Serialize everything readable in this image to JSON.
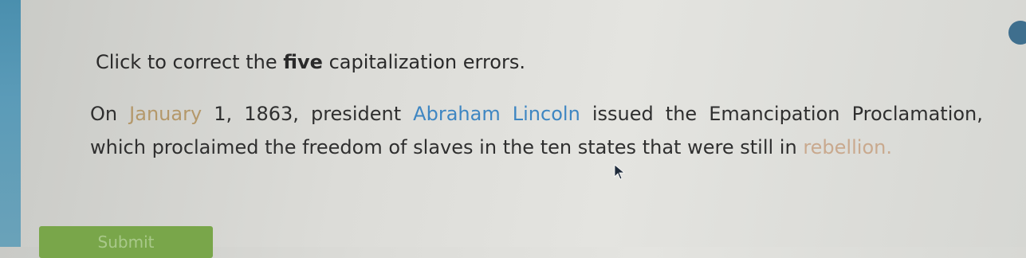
{
  "instructions": {
    "before": "Click to correct the ",
    "bold": "five",
    "after": " capitalization errors."
  },
  "passage": {
    "words": [
      {
        "text": "On",
        "style": "normal"
      },
      {
        "text": "January",
        "style": "amber"
      },
      {
        "text": "1,",
        "style": "normal"
      },
      {
        "text": "1863,",
        "style": "normal"
      },
      {
        "text": "president",
        "style": "normal"
      },
      {
        "text": "Abraham",
        "style": "blue"
      },
      {
        "text": "Lincoln",
        "style": "blue"
      },
      {
        "text": "issued",
        "style": "normal"
      },
      {
        "text": "the",
        "style": "normal"
      },
      {
        "text": "Emancipation",
        "style": "normal"
      },
      {
        "text": "Proclamation,",
        "style": "normal"
      },
      {
        "text": "which",
        "style": "normal"
      },
      {
        "text": "proclaimed",
        "style": "normal"
      },
      {
        "text": "the",
        "style": "normal"
      },
      {
        "text": "freedom",
        "style": "normal"
      },
      {
        "text": "of",
        "style": "normal"
      },
      {
        "text": "slaves",
        "style": "normal"
      },
      {
        "text": "in",
        "style": "normal"
      },
      {
        "text": "the",
        "style": "normal"
      },
      {
        "text": "ten",
        "style": "normal"
      },
      {
        "text": "states",
        "style": "normal"
      },
      {
        "text": "that",
        "style": "normal"
      },
      {
        "text": "were",
        "style": "normal"
      },
      {
        "text": "still",
        "style": "normal"
      },
      {
        "text": "in",
        "style": "normal"
      },
      {
        "text": "rebellion.",
        "style": "faded"
      }
    ]
  },
  "submit": {
    "label": "Submit"
  },
  "colors": {
    "blue_word": "#3e86c2",
    "amber_word": "#b4986a",
    "submit_bg": "#79a64a"
  }
}
